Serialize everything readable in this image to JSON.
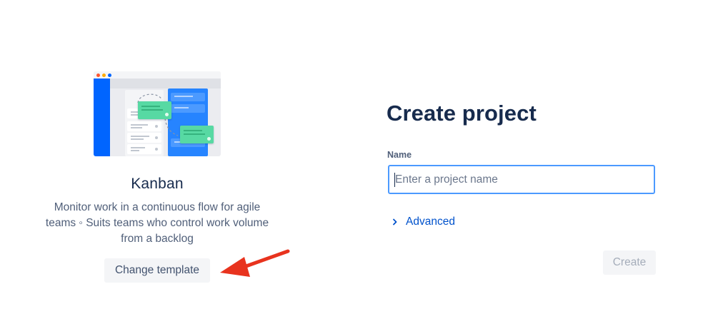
{
  "template": {
    "name": "Kanban",
    "description": "Monitor work in a continuous flow for agile teams ◦ Suits teams who control work volume from a backlog",
    "change_button": "Change template"
  },
  "form": {
    "title": "Create project",
    "name_label": "Name",
    "name_placeholder": "Enter a project name",
    "name_value": "",
    "advanced_label": "Advanced",
    "create_button": "Create",
    "create_disabled": true
  },
  "colors": {
    "accent": "#0052cc",
    "focus_border": "#4c9aff",
    "heading": "#172b4d",
    "annotation_arrow": "#e8331e"
  },
  "icons": [
    "window-dots-icon",
    "chevron-right-icon",
    "annotation-arrow-icon"
  ]
}
